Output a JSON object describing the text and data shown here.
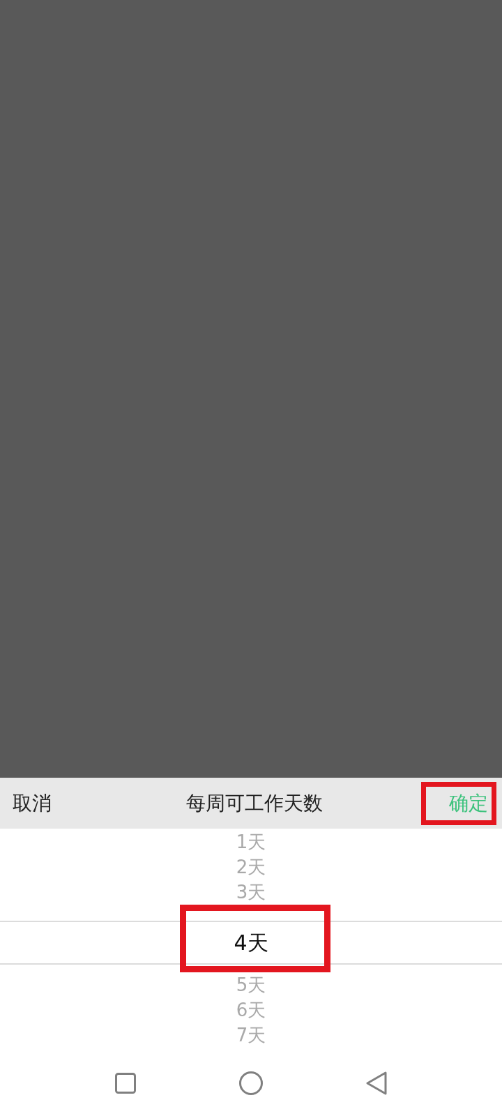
{
  "header": {
    "cancel": "取消",
    "title": "每周可工作天数",
    "confirm": {
      "label": "确定",
      "highlighted": true
    }
  },
  "picker": {
    "options": [
      {
        "label": "1天",
        "selected": false,
        "highlighted": false
      },
      {
        "label": "2天",
        "selected": false,
        "highlighted": false
      },
      {
        "label": "3天",
        "selected": false,
        "highlighted": false
      },
      {
        "label": "4天",
        "selected": true,
        "highlighted": true
      },
      {
        "label": "5天",
        "selected": false,
        "highlighted": false
      },
      {
        "label": "6天",
        "selected": false,
        "highlighted": false
      },
      {
        "label": "7天",
        "selected": false,
        "highlighted": false
      }
    ]
  }
}
